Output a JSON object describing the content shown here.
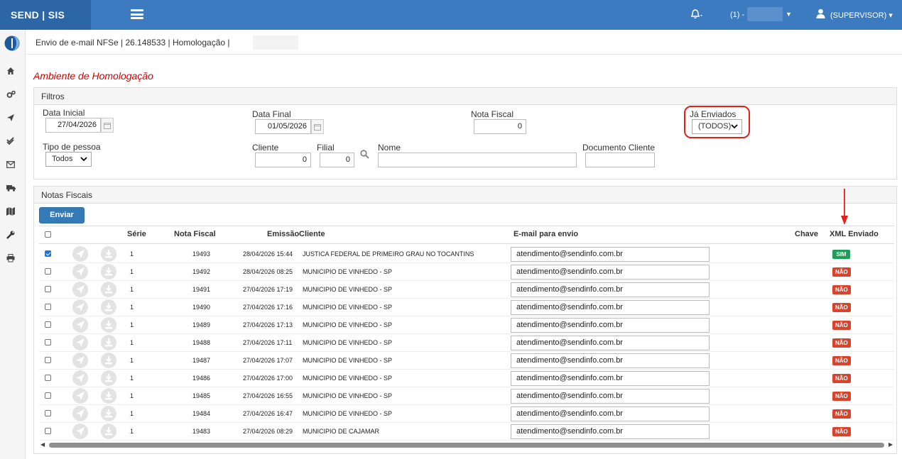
{
  "topbar": {
    "brand": "SEND | SIS",
    "company": "(1) -",
    "user": "(SUPERVISOR)",
    "colors": {
      "bar": "#3c7bbf",
      "brand_bg": "#2c66a6"
    }
  },
  "sidebar": {
    "items": [
      "home-icon",
      "cogs-icon",
      "send-icon",
      "check-icon",
      "envelope-icon",
      "truck-icon",
      "map-icon",
      "wrench-icon",
      "print-icon"
    ]
  },
  "header": {
    "breadcrumb": "Envio de e-mail NFSe | 26.148533 | Homologação |",
    "ambiente": "Ambiente de Homologação"
  },
  "filters": {
    "title": "Filtros",
    "data_inicial_label": "Data Inicial",
    "data_inicial_value": "27/04/2026",
    "data_final_label": "Data Final",
    "data_final_value": "01/05/2026",
    "nota_fiscal_label": "Nota Fiscal",
    "nota_fiscal_value": "0",
    "ja_enviados_label": "Já Enviados",
    "ja_enviados_value": "(TODOS)",
    "tipo_pessoa_label": "Tipo de pessoa",
    "tipo_pessoa_value": "Todos",
    "cliente_label": "Cliente",
    "cliente_value": "0",
    "filial_label": "Filial",
    "filial_value": "0",
    "nome_label": "Nome",
    "nome_value": "",
    "documento_label": "Documento Cliente",
    "documento_value": ""
  },
  "notas": {
    "title": "Notas Fiscais",
    "enviar_label": "Enviar",
    "columns": {
      "serie": "Série",
      "nota": "Nota Fiscal",
      "emissao": "Emissão",
      "cliente": "Cliente",
      "email": "E-mail para envio",
      "chave": "Chave",
      "xml": "XML Enviado"
    },
    "rows": [
      {
        "checked": true,
        "serie": "1",
        "nota": "19493",
        "emissao": "28/04/2026 15:44",
        "cliente": "JUSTICA FEDERAL DE PRIMEIRO GRAU NO TOCANTINS",
        "email": "atendimento@sendinfo.com.br",
        "xml": "SIM"
      },
      {
        "checked": false,
        "serie": "1",
        "nota": "19492",
        "emissao": "28/04/2026 08:25",
        "cliente": "MUNICIPIO DE VINHEDO - SP",
        "email": "atendimento@sendinfo.com.br",
        "xml": "NÃO"
      },
      {
        "checked": false,
        "serie": "1",
        "nota": "19491",
        "emissao": "27/04/2026 17:19",
        "cliente": "MUNICIPIO DE VINHEDO - SP",
        "email": "atendimento@sendinfo.com.br",
        "xml": "NÃO"
      },
      {
        "checked": false,
        "serie": "1",
        "nota": "19490",
        "emissao": "27/04/2026 17:16",
        "cliente": "MUNICIPIO DE VINHEDO - SP",
        "email": "atendimento@sendinfo.com.br",
        "xml": "NÃO"
      },
      {
        "checked": false,
        "serie": "1",
        "nota": "19489",
        "emissao": "27/04/2026 17:13",
        "cliente": "MUNICIPIO DE VINHEDO - SP",
        "email": "atendimento@sendinfo.com.br",
        "xml": "NÃO"
      },
      {
        "checked": false,
        "serie": "1",
        "nota": "19488",
        "emissao": "27/04/2026 17:11",
        "cliente": "MUNICIPIO DE VINHEDO - SP",
        "email": "atendimento@sendinfo.com.br",
        "xml": "NÃO"
      },
      {
        "checked": false,
        "serie": "1",
        "nota": "19487",
        "emissao": "27/04/2026 17:07",
        "cliente": "MUNICIPIO DE VINHEDO - SP",
        "email": "atendimento@sendinfo.com.br",
        "xml": "NÃO"
      },
      {
        "checked": false,
        "serie": "1",
        "nota": "19486",
        "emissao": "27/04/2026 17:00",
        "cliente": "MUNICIPIO DE VINHEDO - SP",
        "email": "atendimento@sendinfo.com.br",
        "xml": "NÃO"
      },
      {
        "checked": false,
        "serie": "1",
        "nota": "19485",
        "emissao": "27/04/2026 16:55",
        "cliente": "MUNICIPIO DE VINHEDO - SP",
        "email": "atendimento@sendinfo.com.br",
        "xml": "NÃO"
      },
      {
        "checked": false,
        "serie": "1",
        "nota": "19484",
        "emissao": "27/04/2026 16:47",
        "cliente": "MUNICIPIO DE VINHEDO - SP",
        "email": "atendimento@sendinfo.com.br",
        "xml": "NÃO"
      },
      {
        "checked": false,
        "serie": "1",
        "nota": "19483",
        "emissao": "27/04/2026 08:29",
        "cliente": "MUNICIPIO DE CAJAMAR",
        "email": "atendimento@sendinfo.com.br",
        "xml": "NÃO"
      }
    ]
  }
}
